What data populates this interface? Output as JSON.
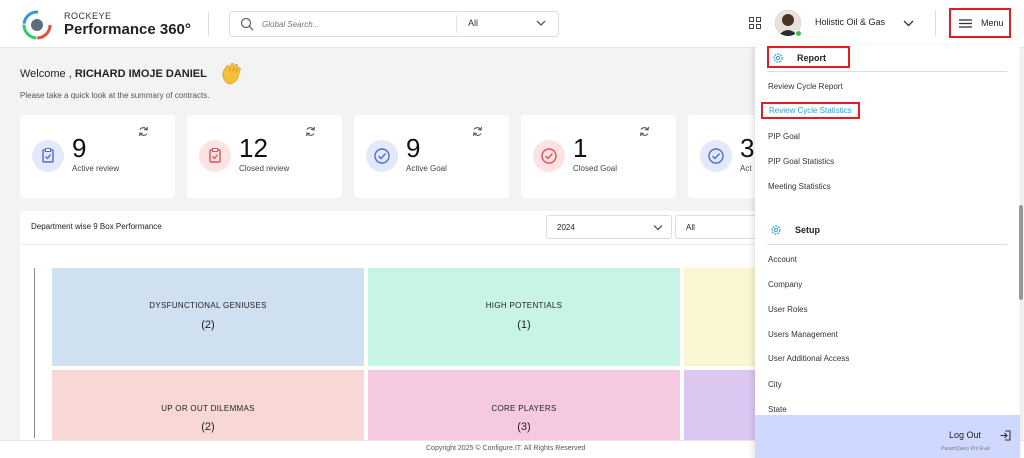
{
  "header": {
    "brand_top": "ROCKEYE",
    "brand_main": "Performance 360°",
    "search_placeholder": "Global Search...",
    "search_category": "All",
    "company": "Holistic Oil & Gas",
    "menu_label": "Menu"
  },
  "welcome": {
    "prefix": "Welcome ,",
    "name": "RICHARD IMOJE DANIEL",
    "subtitle": "Please take a quick look at the summary of contracts."
  },
  "cards": [
    {
      "value": "9",
      "label": "Active review",
      "icon": "clipboard-check-icon",
      "bg": "#e3e8fb",
      "color": "#4f6bd6"
    },
    {
      "value": "12",
      "label": "Closed review",
      "icon": "clipboard-check-icon",
      "bg": "#fde3e3",
      "color": "#e05252"
    },
    {
      "value": "9",
      "label": "Active Goal",
      "icon": "check-circle-icon",
      "bg": "#e3e8fb",
      "color": "#4f6bd6"
    },
    {
      "value": "1",
      "label": "Closed Goal",
      "icon": "check-circle-icon",
      "bg": "#fde3e3",
      "color": "#e05252"
    },
    {
      "value": "3",
      "label": "Act",
      "icon": "check-circle-icon",
      "bg": "#e3e8fb",
      "color": "#4f6bd6"
    }
  ],
  "panel": {
    "title": "Department wise 9 Box Performance",
    "year": "2024",
    "filter": "All",
    "cells": [
      {
        "label": "DYSFUNCTIONAL GENIUSES",
        "count": "(2)",
        "color": "#cfe0f1"
      },
      {
        "label": "HIGH POTENTIALS",
        "count": "(1)",
        "color": "#c8f4e4"
      },
      {
        "label": "",
        "count": "",
        "color": "#faf6d2"
      },
      {
        "label": "UP OR OUT DILEMMAS",
        "count": "(2)",
        "color": "#f8d8d4"
      },
      {
        "label": "CORE PLAYERS",
        "count": "(3)",
        "color": "#f5c9e0"
      },
      {
        "label": "",
        "count": "",
        "color": "#dcc6f2"
      }
    ]
  },
  "footer": "Copyright 2025 © Configure.IT. All Rights Reserved",
  "menu": {
    "report_label": "Report",
    "report_items": [
      "Review Cycle Report",
      "Review Cycle Statistics",
      "PIP Goal",
      "PIP Goal Statistics",
      "Meeting Statistics"
    ],
    "setup_label": "Setup",
    "setup_items": [
      "Account",
      "Company",
      "User Roles",
      "Users Management",
      "User Additional Access",
      "City",
      "State"
    ],
    "logout_label": "Log Out",
    "watermark": "ParamQuery Pro Eval"
  },
  "colors": {
    "accent": "#2aa0d8",
    "highlight_border": "#e21b25",
    "logout_bg": "#cfd9ff"
  }
}
